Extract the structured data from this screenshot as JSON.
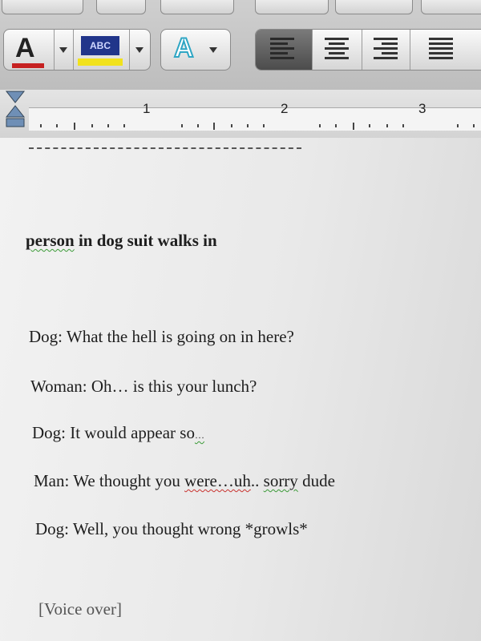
{
  "toolbar": {
    "font_color_letter": "A",
    "highlight_label": "ABC",
    "text_effect_letter": "A",
    "colors": {
      "font_color_bar": "#c62121",
      "highlight_bar": "#f1e21c",
      "text_effect": "#2fa6c4"
    }
  },
  "ruler": {
    "marks": [
      "1",
      "2",
      "3"
    ]
  },
  "document": {
    "stage_direction": {
      "first": "person",
      "rest": " in dog suit walks in"
    },
    "lines": [
      {
        "text": "Dog: What the hell is going on in here?"
      },
      {
        "text": "Woman: Oh… is this your lunch?"
      },
      {
        "text": "Dog: It would appear so",
        "suffix": "…"
      },
      {
        "pre": "Man: We thought you ",
        "err1": "were…uh",
        "mid": ".. ",
        "err2": "sorry",
        "post": " dude"
      },
      {
        "text": "Dog: Well, you thought wrong *growls*"
      }
    ],
    "voice_over": "[Voice over]"
  }
}
